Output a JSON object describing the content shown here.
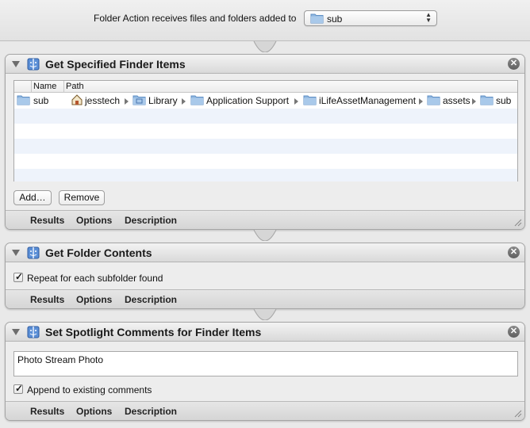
{
  "header": {
    "label": "Folder Action receives files and folders added to",
    "selected_folder": "sub"
  },
  "actions": [
    {
      "title": "Get Specified Finder Items",
      "table": {
        "columns": [
          "Name",
          "Path"
        ],
        "rows": [
          {
            "name": "sub",
            "path": [
              "jesstech",
              "Library",
              "Application Support",
              "iLifeAssetManagement",
              "assets",
              "sub"
            ]
          }
        ]
      },
      "buttons": {
        "add": "Add…",
        "remove": "Remove"
      },
      "footer": {
        "results": "Results",
        "options": "Options",
        "description": "Description"
      }
    },
    {
      "title": "Get Folder Contents",
      "checkbox": {
        "label": "Repeat for each subfolder found",
        "checked": true
      },
      "footer": {
        "results": "Results",
        "options": "Options",
        "description": "Description"
      }
    },
    {
      "title": "Set Spotlight Comments for Finder Items",
      "comment_value": "Photo Stream Photo",
      "checkbox": {
        "label": "Append to existing comments",
        "checked": true
      },
      "footer": {
        "results": "Results",
        "options": "Options",
        "description": "Description"
      }
    }
  ],
  "close_glyph": "✕",
  "check_glyph": "✓",
  "icons": {
    "folder": "folder-icon",
    "home": "home-icon",
    "library": "library-folder-icon",
    "automator_action": "finder-action-icon",
    "close": "close-icon"
  },
  "colors": {
    "folder_blue": "#8fb7e0",
    "alt_row": "#eef3fb"
  }
}
